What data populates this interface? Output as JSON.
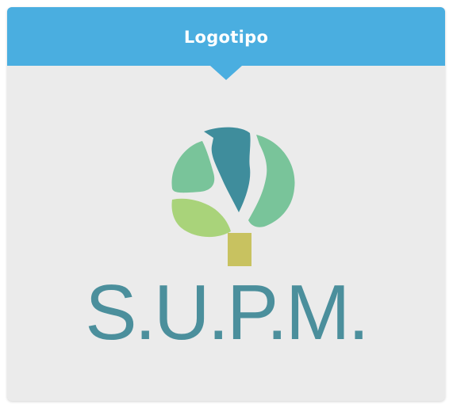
{
  "header": {
    "title": "Logotipo",
    "background_color": "#4aaee0"
  },
  "logo": {
    "icon": "tree-logo-icon",
    "wordmark": "S.U.P.M.",
    "colors": {
      "dark_teal": "#3f8d9c",
      "medium_green": "#79c49a",
      "light_green": "#a9d37a",
      "trunk": "#c8c260",
      "text": "#4b8f9c"
    }
  }
}
